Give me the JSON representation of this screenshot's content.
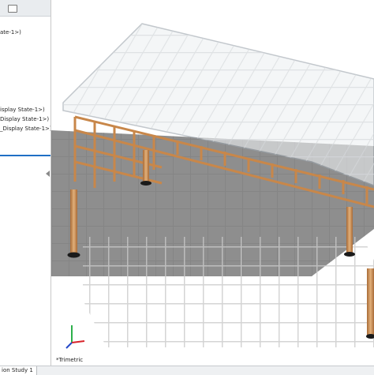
{
  "feature_tree": {
    "items": [
      {
        "label": "ate-1>)"
      },
      {
        "label": "isplay State-1>)"
      },
      {
        "label": "Display State-1>)"
      },
      {
        "label": "_Display State-1>)"
      }
    ]
  },
  "viewport": {
    "view_label": "*Trimetric",
    "triad": {
      "x_color": "#d8232a",
      "y_color": "#2db04b",
      "z_color": "#2548c8"
    }
  },
  "status_bar": {
    "tabs": [
      {
        "label": "ion Study 1"
      }
    ]
  },
  "colors": {
    "frame": "#c8874a",
    "frame_dark": "#9a5e2a",
    "tabletop_edge": "#9aa3ab",
    "shadow": "#8e8e8e",
    "selection": "#1f6fc5"
  }
}
